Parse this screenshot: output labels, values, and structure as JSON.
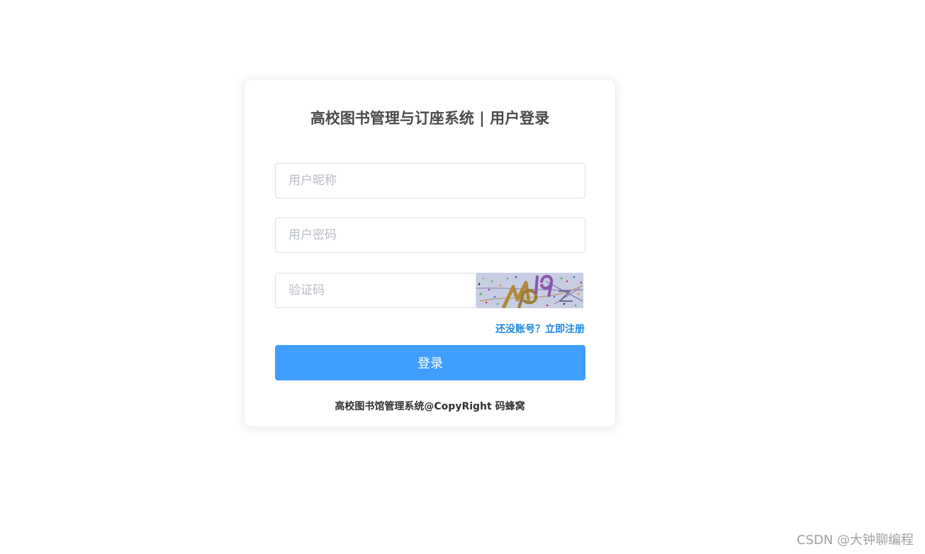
{
  "login": {
    "title": "高校图书管理与订座系统 | 用户登录",
    "username_placeholder": "用户昵称",
    "password_placeholder": "用户密码",
    "captcha_placeholder": "验证码",
    "captcha_text": "wb9z",
    "register_link": "还没账号？立即注册",
    "login_button": "登录",
    "copyright": "高校图书馆管理系统@CopyRight 码蜂窝"
  },
  "watermark": "CSDN @大钟聊编程",
  "colors": {
    "primary": "#409eff",
    "link": "#1e88e5",
    "captcha_bg": "#c7cde2"
  }
}
